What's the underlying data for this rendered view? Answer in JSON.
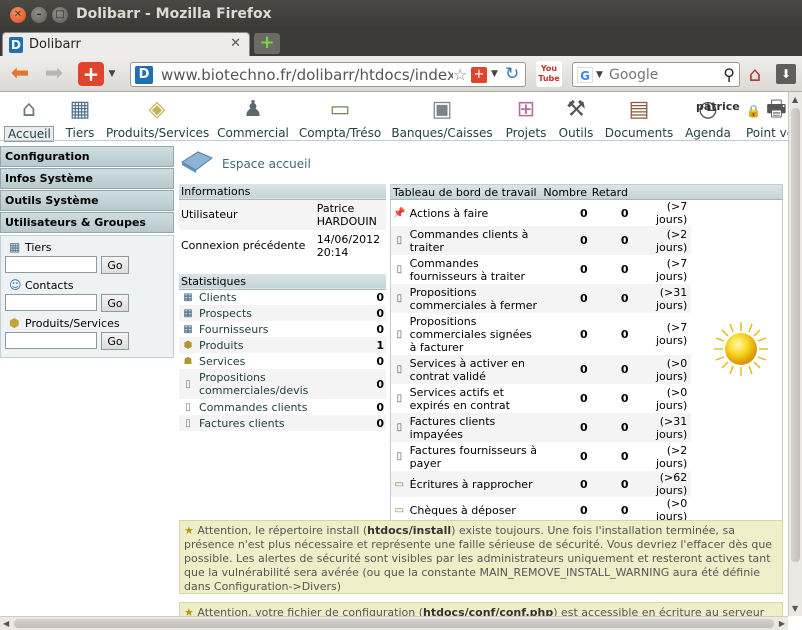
{
  "window": {
    "title": "Dolibarr - Mozilla Firefox",
    "buttons": [
      "close-icon",
      "minimize-icon",
      "maximize-icon"
    ]
  },
  "tabs": [
    {
      "label": "Dolibarr",
      "icon": "dolibarr-favicon"
    }
  ],
  "toolbar": {
    "url": "www.biotechno.fr/dolibarr/htdocs/index.php",
    "search_placeholder": "Google",
    "search_engine_icon": "G"
  },
  "topmenu": [
    {
      "label": "Accueil",
      "icon": "home-icon",
      "active": true
    },
    {
      "label": "Tiers",
      "icon": "building-icon"
    },
    {
      "label": "Produits/Services",
      "icon": "product-icon"
    },
    {
      "label": "Commercial",
      "icon": "commercial-icon"
    },
    {
      "label": "Compta/Tréso",
      "icon": "money-icon"
    },
    {
      "label": "Banques/Caisses",
      "icon": "safe-icon"
    },
    {
      "label": "Projets",
      "icon": "project-icon"
    },
    {
      "label": "Outils",
      "icon": "tools-icon"
    },
    {
      "label": "Documents",
      "icon": "documents-icon"
    },
    {
      "label": "Agenda",
      "icon": "clock-icon"
    },
    {
      "label": "Point ve",
      "icon": "cash-register-icon"
    }
  ],
  "user": {
    "login": "patrice"
  },
  "leftmenu": [
    "Configuration",
    "Infos Système",
    "Outils Système",
    "Utilisateurs & Groupes"
  ],
  "search": {
    "tiers_label": "Tiers",
    "contacts_label": "Contacts",
    "products_label": "Produits/Services",
    "go_label": "Go"
  },
  "page": {
    "title": "Espace accueil"
  },
  "informations": {
    "title": "Informations",
    "rows": [
      {
        "label": "Utilisateur",
        "value_line1": "Patrice",
        "value_line2": "HARDOUIN"
      },
      {
        "label": "Connexion précédente",
        "value_line1": "14/06/2012",
        "value_line2": "20:14"
      }
    ]
  },
  "statistiques": {
    "title": "Statistiques",
    "rows": [
      {
        "label": "Clients",
        "value": "0"
      },
      {
        "label": "Prospects",
        "value": "0"
      },
      {
        "label": "Fournisseurs",
        "value": "0"
      },
      {
        "label": "Produits",
        "value": "1"
      },
      {
        "label": "Services",
        "value": "0"
      },
      {
        "label": "Propositions commerciales/devis",
        "value": "0"
      },
      {
        "label": "Commandes clients",
        "value": "0"
      },
      {
        "label": "Factures clients",
        "value": "0"
      }
    ]
  },
  "dashboard": {
    "title": "Tableau de bord de travail",
    "col_nombre": "Nombre",
    "col_retard": "Retard",
    "rows": [
      {
        "label": "Actions à faire",
        "nombre": "0",
        "retard": "0",
        "delai": "(>7 jours)"
      },
      {
        "label": "Commandes clients à traiter",
        "nombre": "0",
        "retard": "0",
        "delai": "(>2 jours)"
      },
      {
        "label": "Commandes fournisseurs à traiter",
        "nombre": "0",
        "retard": "0",
        "delai": "(>7 jours)"
      },
      {
        "label": "Propositions commerciales à fermer",
        "nombre": "0",
        "retard": "0",
        "delai": "(>31 jours)"
      },
      {
        "label": "Propositions commerciales signées à facturer",
        "nombre": "0",
        "retard": "0",
        "delai": "(>7 jours)"
      },
      {
        "label": "Services à activer en contrat validé",
        "nombre": "0",
        "retard": "0",
        "delai": "(>0 jours)"
      },
      {
        "label": "Services actifs et expirés en contrat",
        "nombre": "0",
        "retard": "0",
        "delai": "(>0 jours)"
      },
      {
        "label": "Factures clients impayées",
        "nombre": "0",
        "retard": "0",
        "delai": "(>31 jours)"
      },
      {
        "label": "Factures fournisseurs à payer",
        "nombre": "0",
        "retard": "0",
        "delai": "(>2 jours)"
      },
      {
        "label": "Écritures à rapprocher",
        "nombre": "0",
        "retard": "0",
        "delai": "(>62 jours)"
      },
      {
        "label": "Chèques à déposer",
        "nombre": "0",
        "retard": "0",
        "delai": "(>0 jours)"
      }
    ],
    "weather_icon": "sun-icon"
  },
  "warnings": [
    {
      "before": "Attention, le répertoire install (",
      "bold": "htdocs/install",
      "after": ") existe toujours. Une fois l'installation terminée, sa présence n'est plus nécessaire et représente une faille sérieuse de sécurité. Vous devriez l'effacer dès que possible. Les alertes de sécurité sont visibles par les administrateurs uniquement et resteront actives tant que la vulnérabilité sera avérée (ou que la constante MAIN_REMOVE_INSTALL_WARNING aura été définie dans Configuration->Divers)"
    },
    {
      "before": "Attention, votre fichier de configuration (",
      "bold": "htdocs/conf/conf.php",
      "after": ") est accessible en écriture au serveur Web."
    }
  ],
  "colors": {
    "accent": "#3c6a78",
    "box_title_bg": "#c5d3d7",
    "warning_bg": "#f0eec8"
  }
}
